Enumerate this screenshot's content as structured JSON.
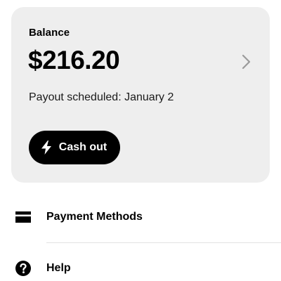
{
  "balance_card": {
    "label": "Balance",
    "amount": "$216.20",
    "payout_text": "Payout scheduled: January 2",
    "cashout_label": "Cash out",
    "chevron_icon": "chevron-right-icon",
    "cashout_icon": "lightning-bolt-icon"
  },
  "menu": {
    "items": [
      {
        "label": "Payment Methods",
        "icon": "credit-card-icon"
      },
      {
        "label": "Help",
        "icon": "question-circle-icon"
      }
    ]
  },
  "colors": {
    "card_background": "#eeeeee",
    "button_background": "#000000",
    "button_text": "#ffffff",
    "divider": "#e3e3e3"
  }
}
